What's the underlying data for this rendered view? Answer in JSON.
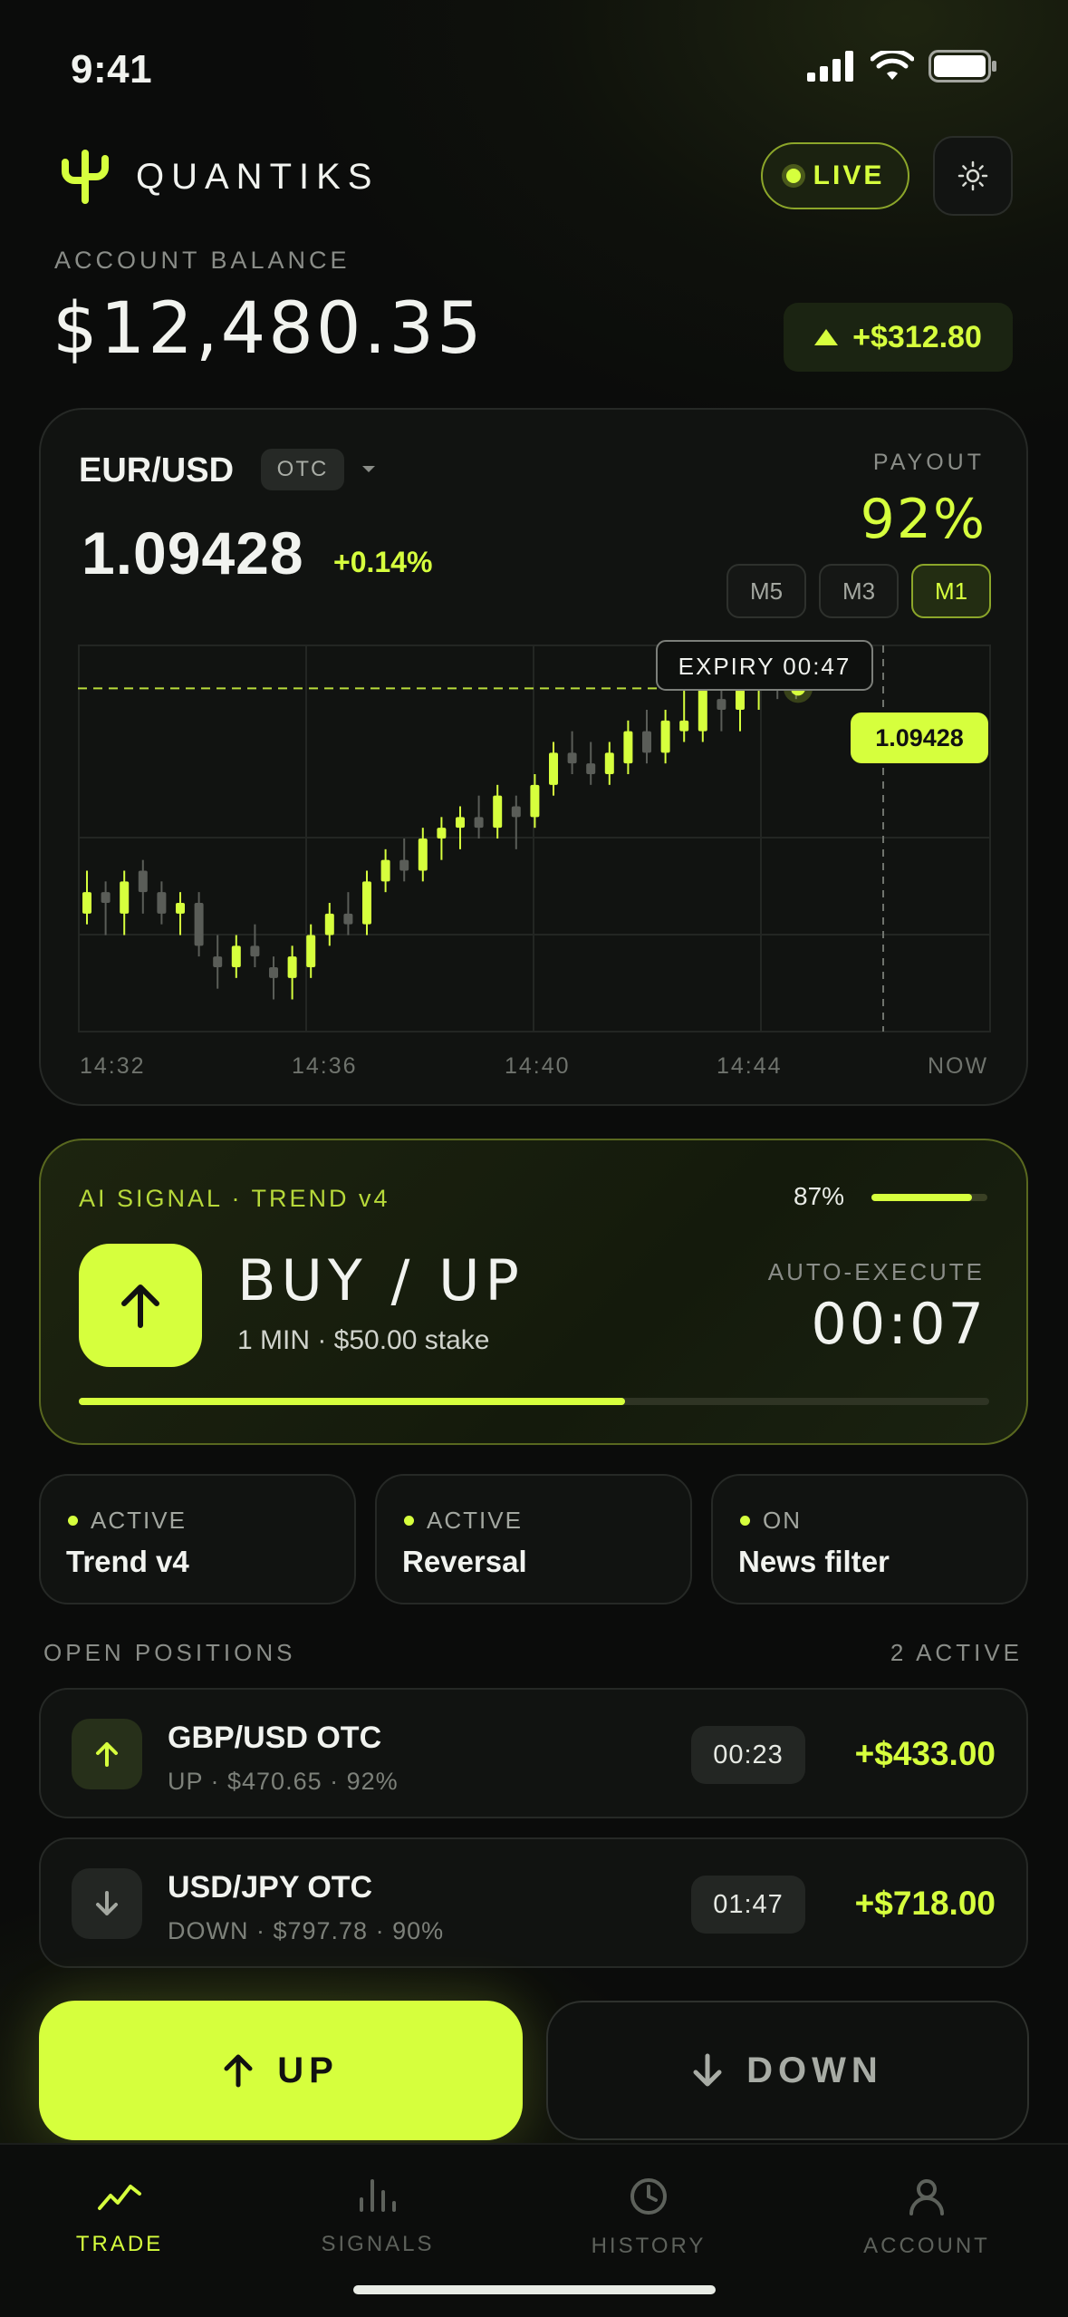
{
  "status_bar": {
    "time": "9:41"
  },
  "header": {
    "brand": "QUANTIKS",
    "live_label": "LIVE"
  },
  "balance": {
    "label": "ACCOUNT BALANCE",
    "value": "$12,480.35",
    "delta": "+$312.80"
  },
  "market": {
    "pair": "EUR/USD",
    "badge": "OTC",
    "price": "1.09428",
    "change": "+0.14%",
    "payout_label": "PAYOUT",
    "payout_value": "92%",
    "timeframes": [
      "M5",
      "M3",
      "M1"
    ],
    "selected_timeframe": "M1",
    "expiry_label": "EXPIRY 00:47",
    "price_tag": "1.09428",
    "time_labels": [
      "14:32",
      "14:36",
      "14:40",
      "14:44",
      "NOW"
    ]
  },
  "signal": {
    "label": "AI SIGNAL · TREND v4",
    "confidence": "87%",
    "confidence_fraction": 0.87,
    "direction": "BUY / UP",
    "stake": "1 MIN · $50.00 stake",
    "auto_label": "AUTO-EXECUTE",
    "auto_timer": "00:07",
    "progress_fraction": 0.6
  },
  "strategies": [
    {
      "status": "ACTIVE",
      "name": "Trend v4"
    },
    {
      "status": "ACTIVE",
      "name": "Reversal"
    },
    {
      "status": "ON",
      "name": "News filter"
    }
  ],
  "positions": {
    "title": "OPEN POSITIONS",
    "count": "2 ACTIVE",
    "items": [
      {
        "pair": "GBP/USD OTC",
        "meta": "UP · $470.65 · 92%",
        "timer": "00:23",
        "pnl": "+$433.00",
        "direction": "up"
      },
      {
        "pair": "USD/JPY OTC",
        "meta": "DOWN · $797.78 · 90%",
        "timer": "01:47",
        "pnl": "+$718.00",
        "direction": "down"
      }
    ]
  },
  "actions": {
    "up": "UP",
    "down": "DOWN"
  },
  "tabs": [
    {
      "label": "TRADE",
      "icon": "trend-icon",
      "active": true
    },
    {
      "label": "SIGNALS",
      "icon": "bars-icon",
      "active": false
    },
    {
      "label": "HISTORY",
      "icon": "clock-icon",
      "active": false
    },
    {
      "label": "ACCOUNT",
      "icon": "user-icon",
      "active": false
    }
  ],
  "colors": {
    "accent": "#d6ff3d",
    "background": "#0b0c0b",
    "card": "#111311"
  },
  "candles": [
    {
      "o": 1.089,
      "h": 1.0892,
      "l": 1.0887,
      "c": 1.0888,
      "bull": true
    },
    {
      "o": 1.0889,
      "h": 1.0891,
      "l": 1.0886,
      "c": 1.089,
      "bull": false
    },
    {
      "o": 1.0888,
      "h": 1.0892,
      "l": 1.0886,
      "c": 1.0891,
      "bull": true
    },
    {
      "o": 1.089,
      "h": 1.0893,
      "l": 1.0888,
      "c": 1.0892,
      "bull": false
    },
    {
      "o": 1.089,
      "h": 1.0891,
      "l": 1.0887,
      "c": 1.0888,
      "bull": false
    },
    {
      "o": 1.0888,
      "h": 1.089,
      "l": 1.0886,
      "c": 1.0889,
      "bull": true
    },
    {
      "o": 1.0889,
      "h": 1.089,
      "l": 1.0884,
      "c": 1.0885,
      "bull": false
    },
    {
      "o": 1.0884,
      "h": 1.0886,
      "l": 1.0881,
      "c": 1.0883,
      "bull": false
    },
    {
      "o": 1.0883,
      "h": 1.0886,
      "l": 1.0882,
      "c": 1.0885,
      "bull": true
    },
    {
      "o": 1.0885,
      "h": 1.0887,
      "l": 1.0883,
      "c": 1.0884,
      "bull": false
    },
    {
      "o": 1.0883,
      "h": 1.0884,
      "l": 1.088,
      "c": 1.0882,
      "bull": false
    },
    {
      "o": 1.0882,
      "h": 1.0885,
      "l": 1.088,
      "c": 1.0884,
      "bull": true
    },
    {
      "o": 1.0883,
      "h": 1.0887,
      "l": 1.0882,
      "c": 1.0886,
      "bull": true
    },
    {
      "o": 1.0886,
      "h": 1.0889,
      "l": 1.0885,
      "c": 1.0888,
      "bull": true
    },
    {
      "o": 1.0888,
      "h": 1.089,
      "l": 1.0886,
      "c": 1.0887,
      "bull": false
    },
    {
      "o": 1.0887,
      "h": 1.0892,
      "l": 1.0886,
      "c": 1.0891,
      "bull": true
    },
    {
      "o": 1.0891,
      "h": 1.0894,
      "l": 1.089,
      "c": 1.0893,
      "bull": true
    },
    {
      "o": 1.0893,
      "h": 1.0895,
      "l": 1.0891,
      "c": 1.0892,
      "bull": false
    },
    {
      "o": 1.0892,
      "h": 1.0896,
      "l": 1.0891,
      "c": 1.0895,
      "bull": true
    },
    {
      "o": 1.0895,
      "h": 1.0897,
      "l": 1.0893,
      "c": 1.0896,
      "bull": true
    },
    {
      "o": 1.0896,
      "h": 1.0898,
      "l": 1.0894,
      "c": 1.0897,
      "bull": true
    },
    {
      "o": 1.0897,
      "h": 1.0899,
      "l": 1.0895,
      "c": 1.0896,
      "bull": false
    },
    {
      "o": 1.0896,
      "h": 1.09,
      "l": 1.0895,
      "c": 1.0899,
      "bull": true
    },
    {
      "o": 1.0898,
      "h": 1.0899,
      "l": 1.0894,
      "c": 1.0897,
      "bull": false
    },
    {
      "o": 1.0897,
      "h": 1.0901,
      "l": 1.0896,
      "c": 1.09,
      "bull": true
    },
    {
      "o": 1.09,
      "h": 1.0904,
      "l": 1.0899,
      "c": 1.0903,
      "bull": true
    },
    {
      "o": 1.0903,
      "h": 1.0905,
      "l": 1.0901,
      "c": 1.0902,
      "bull": false
    },
    {
      "o": 1.0902,
      "h": 1.0904,
      "l": 1.09,
      "c": 1.0901,
      "bull": false
    },
    {
      "o": 1.0901,
      "h": 1.0904,
      "l": 1.09,
      "c": 1.0903,
      "bull": true
    },
    {
      "o": 1.0902,
      "h": 1.0906,
      "l": 1.0901,
      "c": 1.0905,
      "bull": true
    },
    {
      "o": 1.0905,
      "h": 1.0907,
      "l": 1.0902,
      "c": 1.0903,
      "bull": false
    },
    {
      "o": 1.0903,
      "h": 1.0907,
      "l": 1.0902,
      "c": 1.0906,
      "bull": true
    },
    {
      "o": 1.0906,
      "h": 1.0909,
      "l": 1.0904,
      "c": 1.0905,
      "bull": true
    },
    {
      "o": 1.0905,
      "h": 1.091,
      "l": 1.0904,
      "c": 1.0909,
      "bull": true
    },
    {
      "o": 1.0908,
      "h": 1.091,
      "l": 1.0905,
      "c": 1.0907,
      "bull": false
    },
    {
      "o": 1.0907,
      "h": 1.091,
      "l": 1.0905,
      "c": 1.0909,
      "bull": true
    },
    {
      "o": 1.0909,
      "h": 1.0912,
      "l": 1.0907,
      "c": 1.0911,
      "bull": true
    },
    {
      "o": 1.091,
      "h": 1.0912,
      "l": 1.0908,
      "c": 1.0909,
      "bull": false
    },
    {
      "o": 1.0909,
      "h": 1.0911,
      "l": 1.0908,
      "c": 1.0909,
      "bull": false
    }
  ],
  "price_line": 1.09428
}
